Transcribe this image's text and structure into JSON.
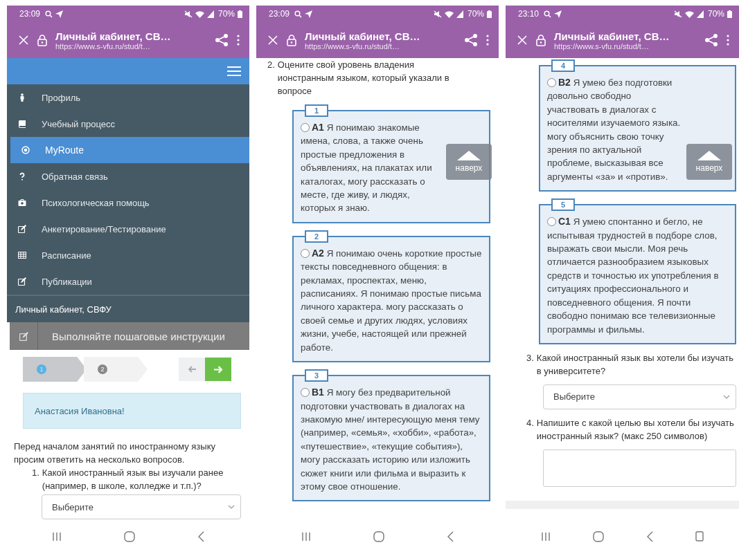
{
  "screens": [
    {
      "kind": "menu",
      "status": {
        "time": "23:09",
        "battery": "70%"
      },
      "browser": {
        "title": "Личный кабинет, СВ…",
        "url": "https://www.s-vfu.ru/stud/t…"
      },
      "sidebar": {
        "items": [
          {
            "label": "Профиль",
            "selected": false
          },
          {
            "label": "Учебный процесс",
            "selected": false
          },
          {
            "label": "MyRoute",
            "selected": true
          },
          {
            "label": "Обратная связь",
            "selected": false
          },
          {
            "label": "Психологическая помощь",
            "selected": false
          },
          {
            "label": "Анкетирование/Тестирование",
            "selected": false
          },
          {
            "label": "Расписание",
            "selected": false
          },
          {
            "label": "Публикации",
            "selected": false
          }
        ],
        "footer": "Личный кабинет, СВФУ"
      },
      "banner": "Выполняйте пошаговые инструкции",
      "steps": [
        {
          "label": "1",
          "selected": true
        },
        {
          "label": "2",
          "selected": false
        }
      ],
      "alert": "Анастасия Ивановна!",
      "intro": "Перед началом занятий по иностранному языку просим ответить на несколько вопросов.",
      "blocks": [
        {
          "kind": "question",
          "number": "1.",
          "text": "Какой иностранный язык вы изучали ранее (например, в школе, колледже и т.п.)?"
        },
        {
          "kind": "select",
          "value": "Выберите"
        }
      ]
    },
    {
      "kind": "form",
      "status": {
        "time": "23:09",
        "battery": "70%"
      },
      "browser": {
        "title": "Личный кабинет, СВ…",
        "url": "https://www.s-vfu.ru/stud/t…"
      },
      "scroll_top": "наверх",
      "blocks": [
        {
          "kind": "question",
          "number": "2.",
          "text": "Оцените свой уровень владения ионстранным языком, который указали в вопросе"
        },
        {
          "kind": "level",
          "number": "1",
          "code": "A1",
          "text": "Я понимаю знакомые имена, слова, а также очень простые предложения в объявлениях, на плакатах или каталогах, могу рассказать о месте, где живу, и людях, которых я знаю.",
          "selected": false
        },
        {
          "kind": "level",
          "number": "2",
          "code": "A2",
          "text": "Я понимаю очень короткие простые тексты повседневного общения: в рекламах, проспектах, меню, расписаниях. Я понимаю простые письма личного характера. могу рассказать о своей семье и других людях, условиях жизни, учебе, настоящей или прежней работе.",
          "selected": false
        },
        {
          "kind": "level",
          "number": "3",
          "code": "B1",
          "text": "Я могу без предварительной подготовки участвовать в диалогах на знакомую мне/ интересующую меня тему (например, «семья», «хобби», «работа», «путешествие», «текущие события»), могу рассказать историю или изложить сюжет книги или фильма и выразить к этому свое отношение.",
          "selected": false
        }
      ]
    },
    {
      "kind": "form",
      "status": {
        "time": "23:10",
        "battery": "70%"
      },
      "browser": {
        "title": "Личный кабинет, СВ…",
        "url": "https://www.s-vfu.ru/stud/t…"
      },
      "scroll_top": "наверх",
      "blocks": [
        {
          "kind": "level",
          "number": "4",
          "code": "B2",
          "text": "Я умею без подготовки довольно свободно участвовать в диалогах с носителями изучаемого языка. могу объяснить свою точку зрения по актуальной проблеме, высказывая все аргументы «за» и «против».",
          "selected": false
        },
        {
          "kind": "level",
          "number": "5",
          "code": "C1",
          "text": "Я умею спонтанно и бегло, не испытывая трудностей в подборе слов, выражать свои мысли. Моя речь отличается разнообразием языковых средств и точностью их употребления в ситуациях профессионального и повседневного общения. Я почти свободно понимаю все телевизионные программы и фильмы.",
          "selected": false
        },
        {
          "kind": "question",
          "number": "3.",
          "text": "Какой иностранный язык вы хотели бы изучать в университете?"
        },
        {
          "kind": "select",
          "value": "Выберите"
        },
        {
          "kind": "question",
          "number": "4.",
          "text": "Напишите с какой целью вы хотели бы изучать иностранный язык? (макс 250 символов)"
        },
        {
          "kind": "textarea"
        }
      ]
    }
  ]
}
